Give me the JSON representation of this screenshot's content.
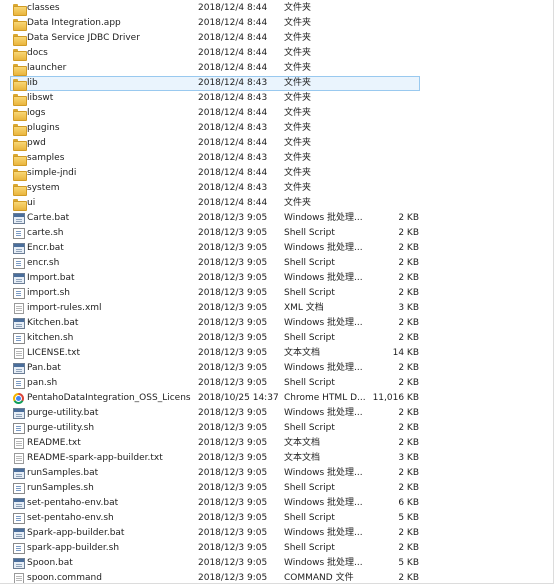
{
  "files": [
    {
      "name": "classes",
      "date": "2018/12/4 8:44",
      "type": "文件夹",
      "size": "",
      "icon": "folder-icon"
    },
    {
      "name": "Data Integration.app",
      "date": "2018/12/4 8:44",
      "type": "文件夹",
      "size": "",
      "icon": "folder-icon"
    },
    {
      "name": "Data Service JDBC Driver",
      "date": "2018/12/4 8:44",
      "type": "文件夹",
      "size": "",
      "icon": "folder-icon"
    },
    {
      "name": "docs",
      "date": "2018/12/4 8:44",
      "type": "文件夹",
      "size": "",
      "icon": "folder-icon"
    },
    {
      "name": "launcher",
      "date": "2018/12/4 8:44",
      "type": "文件夹",
      "size": "",
      "icon": "folder-icon"
    },
    {
      "name": "lib",
      "date": "2018/12/4 8:43",
      "type": "文件夹",
      "size": "",
      "icon": "folder-icon",
      "selected": true
    },
    {
      "name": "libswt",
      "date": "2018/12/4 8:43",
      "type": "文件夹",
      "size": "",
      "icon": "folder-icon"
    },
    {
      "name": "logs",
      "date": "2018/12/4 8:44",
      "type": "文件夹",
      "size": "",
      "icon": "folder-icon"
    },
    {
      "name": "plugins",
      "date": "2018/12/4 8:43",
      "type": "文件夹",
      "size": "",
      "icon": "folder-icon"
    },
    {
      "name": "pwd",
      "date": "2018/12/4 8:44",
      "type": "文件夹",
      "size": "",
      "icon": "folder-icon"
    },
    {
      "name": "samples",
      "date": "2018/12/4 8:43",
      "type": "文件夹",
      "size": "",
      "icon": "folder-icon"
    },
    {
      "name": "simple-jndi",
      "date": "2018/12/4 8:44",
      "type": "文件夹",
      "size": "",
      "icon": "folder-icon"
    },
    {
      "name": "system",
      "date": "2018/12/4 8:43",
      "type": "文件夹",
      "size": "",
      "icon": "folder-icon"
    },
    {
      "name": "ui",
      "date": "2018/12/4 8:44",
      "type": "文件夹",
      "size": "",
      "icon": "folder-icon"
    },
    {
      "name": "Carte.bat",
      "date": "2018/12/3 9:05",
      "type": "Windows 批处理...",
      "size": "2 KB",
      "icon": "batch-file-icon"
    },
    {
      "name": "carte.sh",
      "date": "2018/12/3 9:05",
      "type": "Shell Script",
      "size": "2 KB",
      "icon": "shell-script-icon"
    },
    {
      "name": "Encr.bat",
      "date": "2018/12/3 9:05",
      "type": "Windows 批处理...",
      "size": "2 KB",
      "icon": "batch-file-icon"
    },
    {
      "name": "encr.sh",
      "date": "2018/12/3 9:05",
      "type": "Shell Script",
      "size": "2 KB",
      "icon": "shell-script-icon"
    },
    {
      "name": "Import.bat",
      "date": "2018/12/3 9:05",
      "type": "Windows 批处理...",
      "size": "2 KB",
      "icon": "batch-file-icon"
    },
    {
      "name": "import.sh",
      "date": "2018/12/3 9:05",
      "type": "Shell Script",
      "size": "2 KB",
      "icon": "shell-script-icon"
    },
    {
      "name": "import-rules.xml",
      "date": "2018/12/3 9:05",
      "type": "XML 文档",
      "size": "3 KB",
      "icon": "document-icon"
    },
    {
      "name": "Kitchen.bat",
      "date": "2018/12/3 9:05",
      "type": "Windows 批处理...",
      "size": "2 KB",
      "icon": "batch-file-icon"
    },
    {
      "name": "kitchen.sh",
      "date": "2018/12/3 9:05",
      "type": "Shell Script",
      "size": "2 KB",
      "icon": "shell-script-icon"
    },
    {
      "name": "LICENSE.txt",
      "date": "2018/12/3 9:05",
      "type": "文本文档",
      "size": "14 KB",
      "icon": "document-icon"
    },
    {
      "name": "Pan.bat",
      "date": "2018/12/3 9:05",
      "type": "Windows 批处理...",
      "size": "2 KB",
      "icon": "batch-file-icon"
    },
    {
      "name": "pan.sh",
      "date": "2018/12/3 9:05",
      "type": "Shell Script",
      "size": "2 KB",
      "icon": "shell-script-icon"
    },
    {
      "name": "PentahoDataIntegration_OSS_License...",
      "date": "2018/10/25 14:37",
      "type": "Chrome HTML D...",
      "size": "11,016 KB",
      "icon": "chrome-icon"
    },
    {
      "name": "purge-utility.bat",
      "date": "2018/12/3 9:05",
      "type": "Windows 批处理...",
      "size": "2 KB",
      "icon": "batch-file-icon"
    },
    {
      "name": "purge-utility.sh",
      "date": "2018/12/3 9:05",
      "type": "Shell Script",
      "size": "2 KB",
      "icon": "shell-script-icon"
    },
    {
      "name": "README.txt",
      "date": "2018/12/3 9:05",
      "type": "文本文档",
      "size": "2 KB",
      "icon": "document-icon"
    },
    {
      "name": "README-spark-app-builder.txt",
      "date": "2018/12/3 9:05",
      "type": "文本文档",
      "size": "3 KB",
      "icon": "document-icon"
    },
    {
      "name": "runSamples.bat",
      "date": "2018/12/3 9:05",
      "type": "Windows 批处理...",
      "size": "2 KB",
      "icon": "batch-file-icon"
    },
    {
      "name": "runSamples.sh",
      "date": "2018/12/3 9:05",
      "type": "Shell Script",
      "size": "2 KB",
      "icon": "shell-script-icon"
    },
    {
      "name": "set-pentaho-env.bat",
      "date": "2018/12/3 9:05",
      "type": "Windows 批处理...",
      "size": "6 KB",
      "icon": "batch-file-icon"
    },
    {
      "name": "set-pentaho-env.sh",
      "date": "2018/12/3 9:05",
      "type": "Shell Script",
      "size": "5 KB",
      "icon": "shell-script-icon"
    },
    {
      "name": "Spark-app-builder.bat",
      "date": "2018/12/3 9:05",
      "type": "Windows 批处理...",
      "size": "2 KB",
      "icon": "batch-file-icon"
    },
    {
      "name": "spark-app-builder.sh",
      "date": "2018/12/3 9:05",
      "type": "Shell Script",
      "size": "2 KB",
      "icon": "shell-script-icon"
    },
    {
      "name": "Spoon.bat",
      "date": "2018/12/3 9:05",
      "type": "Windows 批处理...",
      "size": "5 KB",
      "icon": "batch-file-icon"
    },
    {
      "name": "spoon.command",
      "date": "2018/12/3 9:05",
      "type": "COMMAND 文件",
      "size": "2 KB",
      "icon": "document-icon"
    }
  ]
}
